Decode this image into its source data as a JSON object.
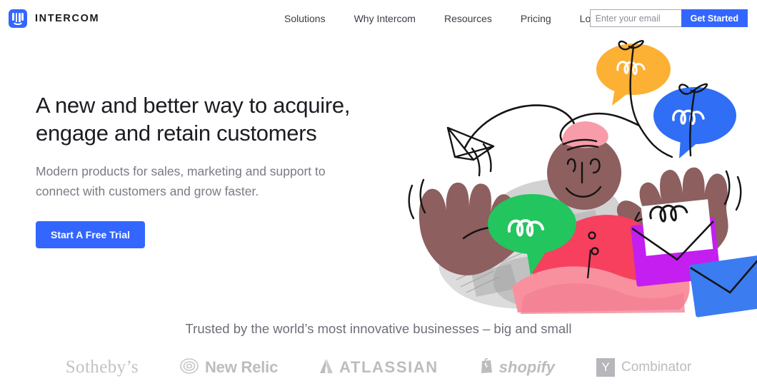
{
  "header": {
    "brand": {
      "name": "INTERCOM",
      "icon": "intercom-logo-icon",
      "color": "#3366ff"
    },
    "nav": [
      {
        "label": "Solutions"
      },
      {
        "label": "Why Intercom"
      },
      {
        "label": "Resources"
      },
      {
        "label": "Pricing"
      },
      {
        "label": "Log in"
      }
    ],
    "signup": {
      "email_placeholder": "Enter your email",
      "email_value": "",
      "button_label": "Get Started"
    }
  },
  "hero": {
    "title_line1": "A new and better way to acquire,",
    "title_line2": "engage and retain customers",
    "sub_line1": "Modern products for sales, marketing and support to",
    "sub_line2": "connect with customers and grow faster.",
    "cta_label": "Start A Free Trial"
  },
  "illustration": {
    "name": "hero-illustration-person-with-messages",
    "colors": {
      "bubble_orange": "#fcb034",
      "bubble_blue": "#2f6ef5",
      "bubble_green": "#22c55e",
      "envelope_purple": "#b724f0",
      "envelope_magenta": "#e020f0",
      "envelope_blue": "#3b7cf0",
      "skin": "#8d5f5f",
      "shirt_red": "#f6405e",
      "shirt_pink": "#f9909e",
      "hair_pink": "#f79ca8",
      "collage_gray": "#c9c9c9",
      "ink": "#141414"
    }
  },
  "trust": {
    "headline": "Trusted by the world’s most innovative businesses – big and small",
    "logos": [
      {
        "name": "Sotheby’s"
      },
      {
        "name": "New Relic"
      },
      {
        "name": "ATLASSIAN"
      },
      {
        "name": "shopify"
      },
      {
        "name": "Y",
        "suffix": "Combinator"
      }
    ]
  }
}
